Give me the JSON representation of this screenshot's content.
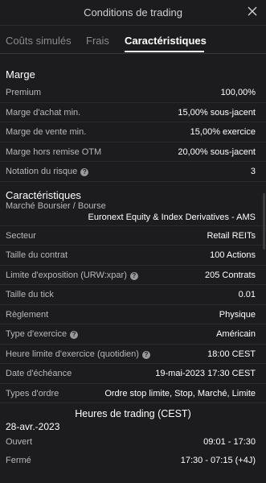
{
  "header": {
    "title": "Conditions de trading"
  },
  "tabs": [
    {
      "label": "Coûts simulés"
    },
    {
      "label": "Frais"
    },
    {
      "label": "Caractéristiques"
    }
  ],
  "marge": {
    "title": "Marge",
    "rows": [
      {
        "label": "Premium",
        "value": "100,00%"
      },
      {
        "label": "Marge d'achat min.",
        "value": "15,00% sous-jacent"
      },
      {
        "label": "Marge de vente min.",
        "value": "15,00% exercice"
      },
      {
        "label": "Marge hors remise OTM",
        "value": "20,00% sous-jacent"
      },
      {
        "label": "Notation du risque",
        "value": "3"
      }
    ]
  },
  "carac": {
    "title": "Caractéristiques",
    "market_label": "Marché Boursier / Bourse",
    "market_value": "Euronext Equity & Index Derivatives - AMS",
    "rows": [
      {
        "label": "Secteur",
        "value": "Retail REITs"
      },
      {
        "label": "Taille du contrat",
        "value": "100 Actions"
      },
      {
        "label": "Limite d'exposition (URW:xpar)",
        "value": "205 Contrats"
      },
      {
        "label": "Taille du tick",
        "value": "0.01"
      },
      {
        "label": "Règlement",
        "value": "Physique"
      },
      {
        "label": "Type d'exercice",
        "value": "Américain"
      },
      {
        "label": "Heure limite d'exercice (quotidien)",
        "value": "18:00 CEST"
      },
      {
        "label": "Date d'échéance",
        "value": "19-mai-2023 17:30 CEST"
      },
      {
        "label": "Types d'ordre",
        "value": "Ordre stop limite, Stop, Marché, Limite"
      }
    ]
  },
  "hours": {
    "title": "Heures de trading (CEST)",
    "date": "28-avr.-2023",
    "rows": [
      {
        "label": "Ouvert",
        "value": "09:01 - 17:30"
      },
      {
        "label": "Fermé",
        "value": "17:30 - 07:15 (+4J)"
      }
    ]
  },
  "icons": {
    "info": "?"
  }
}
